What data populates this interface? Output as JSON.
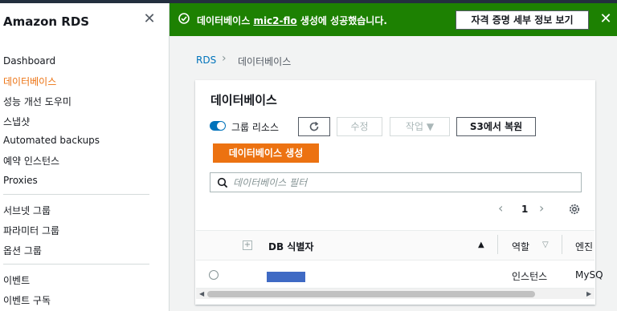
{
  "sidebar": {
    "title": "Amazon RDS",
    "close_icon": "close-icon",
    "items": [
      {
        "label": "Dashboard"
      },
      {
        "label": "데이터베이스",
        "active": true
      },
      {
        "label": "성능 개선 도우미"
      },
      {
        "label": "스냅샷"
      },
      {
        "label": "Automated backups"
      },
      {
        "label": "예약 인스턴스"
      },
      {
        "label": "Proxies"
      },
      {
        "label": "서브넷 그룹"
      },
      {
        "label": "파라미터 그룹"
      },
      {
        "label": "옵션 그룹"
      },
      {
        "label": "이벤트"
      },
      {
        "label": "이벤트 구독"
      }
    ]
  },
  "flash": {
    "prefix": "데이터베이스",
    "db_name": "mic2-flo",
    "suffix": "생성에 성공했습니다.",
    "button_label": "자격 증명 세부 정보 보기",
    "color": "#1d8102"
  },
  "breadcrumb": {
    "root": "RDS",
    "current": "데이터베이스"
  },
  "panel": {
    "title": "데이터베이스",
    "group_toggle_label": "그룹 리소스",
    "edit_label": "수정",
    "actions_label": "작업",
    "restore_s3_label": "S3에서 복원",
    "create_label": "데이터베이스 생성",
    "search_placeholder": "데이터베이스 필터",
    "page_number": "1",
    "columns": {
      "id": "DB 식별자",
      "role": "역할",
      "engine": "엔진"
    },
    "rows": [
      {
        "role": "인스턴스",
        "engine": "MySQ"
      }
    ]
  },
  "colors": {
    "accent": "#ec7211",
    "link": "#0073bb",
    "success": "#1d8102"
  }
}
